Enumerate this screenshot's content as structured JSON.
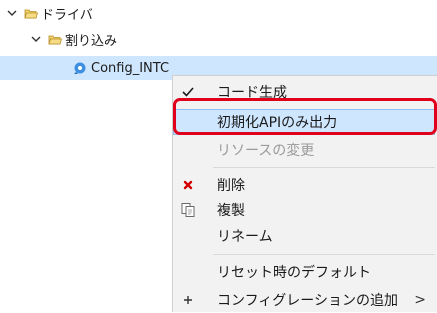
{
  "tree": {
    "driver": {
      "label": "ドライバ"
    },
    "interrupt": {
      "label": "割り込み"
    },
    "config": {
      "label": "Config_INTC"
    }
  },
  "menu": {
    "items": [
      {
        "label": "コード生成",
        "checked": true,
        "enabled": true
      },
      {
        "label": "初期化APIのみ出力",
        "enabled": true,
        "highlighted": true
      },
      {
        "label": "リソースの変更",
        "enabled": false
      },
      {
        "label": "削除",
        "icon": "delete-x-icon",
        "enabled": true
      },
      {
        "label": "複製",
        "icon": "copy-icon",
        "enabled": true
      },
      {
        "label": "リネーム",
        "enabled": true
      },
      {
        "label": "リセット時のデフォルト",
        "enabled": true
      },
      {
        "label": "コンフィグレーションの追加",
        "icon": "plus-icon",
        "enabled": true,
        "submenu": true
      }
    ],
    "submenu_arrow": ">"
  },
  "colors": {
    "selection": "#cfe6ff",
    "callout": "#e0001b",
    "delete": "#d40000"
  }
}
